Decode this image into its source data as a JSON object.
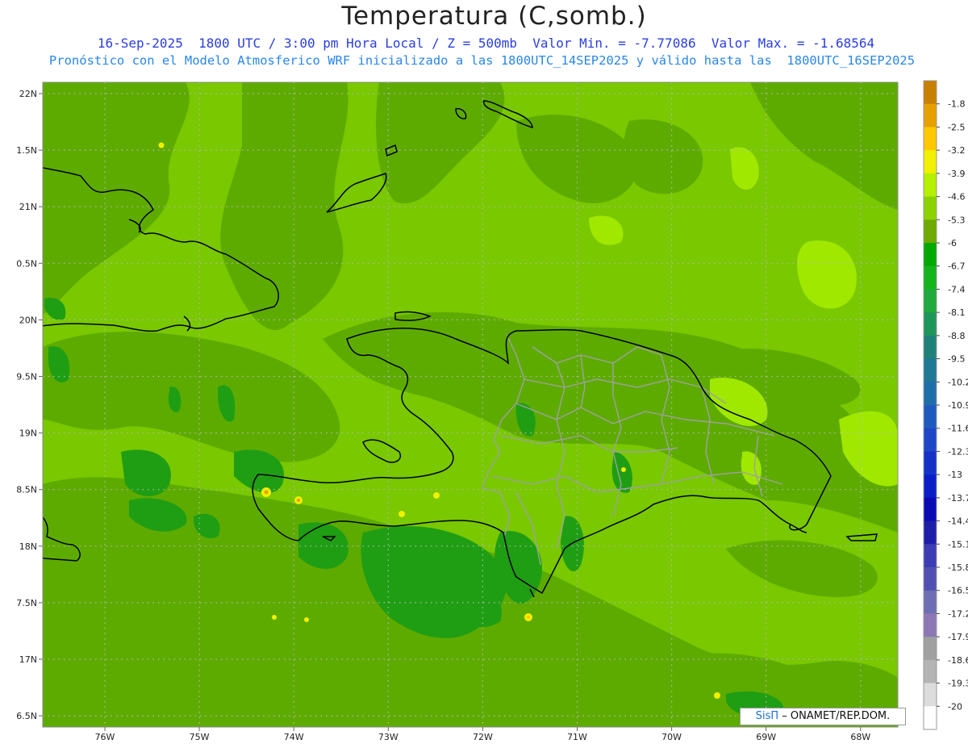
{
  "header": {
    "title": "Temperatura (C,somb.)",
    "subtitle_line1": "16-Sep-2025  1800 UTC / 3:00 pm Hora Local / Z = 500mb  Valor Min. = -7.77086  Valor Max. = -1.68564",
    "subtitle_line2": "Pronóstico con el Modelo Atmosferico WRF inicializado a las 1800UTC_14SEP2025 y válido hasta las  1800UTC_16SEP2025"
  },
  "axes": {
    "lon_labels": [
      "76W",
      "75W",
      "74W",
      "73W",
      "72W",
      "71W",
      "70W",
      "69W",
      "68W"
    ],
    "lat_labels": [
      "22N",
      "1.5N",
      "21N",
      "0.5N",
      "20N",
      "9.5N",
      "19N",
      "8.5N",
      "18N",
      "7.5N",
      "17N",
      "6.5N"
    ]
  },
  "colorbar": {
    "labels": [
      "-1.8",
      "-2.5",
      "-3.2",
      "-3.9",
      "-4.6",
      "-5.3",
      "-6",
      "-6.7",
      "-7.4",
      "-8.1",
      "-8.8",
      "-9.5",
      "-10.2",
      "-10.9",
      "-11.6",
      "-12.3",
      "-13",
      "-13.7",
      "-14.4",
      "-15.1",
      "-15.8",
      "-16.5",
      "-17.2",
      "-17.9",
      "-18.6",
      "-19.3",
      "-20"
    ],
    "colors": [
      "#c88000",
      "#e6a000",
      "#ffc800",
      "#f0f000",
      "#b4f000",
      "#8cd200",
      "#6eaa00",
      "#00aa00",
      "#14b41e",
      "#1eaa3c",
      "#1e965a",
      "#1e8278",
      "#1e7896",
      "#1e6eaa",
      "#1e5abe",
      "#1e46c8",
      "#1432c8",
      "#0a1ec8",
      "#0a0ab4",
      "#1e1eaa",
      "#3c3cb4",
      "#5050b4",
      "#6e6eb4",
      "#8c78b4",
      "#a0a0a0",
      "#b4b4b4",
      "#dcdcdc",
      "#ffffff"
    ]
  },
  "map_colors": {
    "base": "#79c800",
    "dark": "#5eab00",
    "darker": "#1f9e14",
    "light": "#a0e800",
    "coast": "#000000",
    "borders": "#a0a0a0"
  },
  "credit": {
    "sis": "SisΠ",
    "org": "– ONAMET/REP.DOM."
  }
}
